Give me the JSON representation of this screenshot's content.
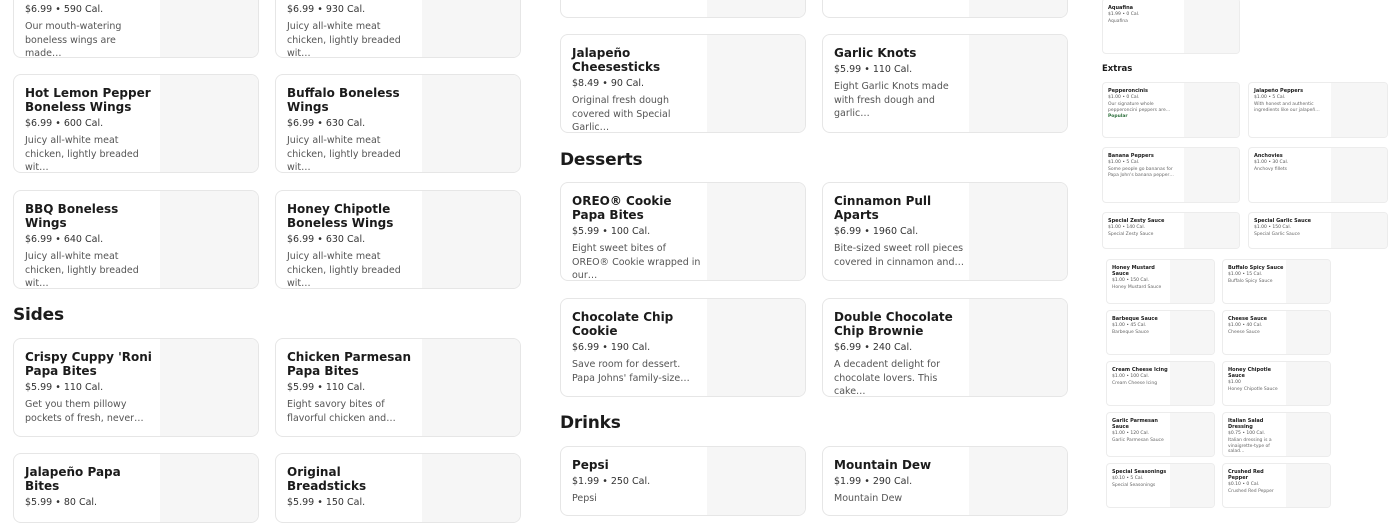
{
  "col1": [
    {
      "name": "",
      "meta": "$6.99 • 590 Cal.",
      "desc": "Our mouth-watering boneless wings are made…"
    },
    {
      "name": "Hot Lemon Pepper Boneless Wings",
      "meta": "$6.99 • 600 Cal.",
      "desc": "Juicy all-white meat chicken, lightly breaded wit…"
    },
    {
      "name": "BBQ Boneless Wings",
      "meta": "$6.99 • 640 Cal.",
      "desc": "Juicy all-white meat chicken, lightly breaded wit…"
    },
    {
      "name": "Crispy Cuppy 'Roni Papa Bites",
      "meta": "$5.99 • 110 Cal.",
      "desc": "Get you them pillowy pockets of fresh, never…"
    },
    {
      "name": "Jalapeño Papa Bites",
      "meta": "$5.99 • 80 Cal.",
      "desc": ""
    }
  ],
  "col2": [
    {
      "name": "",
      "meta": "$6.99 • 930 Cal.",
      "desc": "Juicy all-white meat chicken, lightly breaded wit…"
    },
    {
      "name": "Buffalo Boneless Wings",
      "meta": "$6.99 • 630 Cal.",
      "desc": "Juicy all-white meat chicken, lightly breaded wit…"
    },
    {
      "name": "Honey Chipotle Boneless Wings",
      "meta": "$6.99 • 630 Cal.",
      "desc": "Juicy all-white meat chicken, lightly breaded wit…"
    },
    {
      "name": "Chicken Parmesan Papa Bites",
      "meta": "$5.99 • 110 Cal.",
      "desc": "Eight savory bites of flavorful chicken and…"
    },
    {
      "name": "Original Breadsticks",
      "meta": "$5.99 • 150 Cal.",
      "desc": ""
    }
  ],
  "sections": {
    "sides": "Sides",
    "desserts": "Desserts",
    "drinks": "Drinks",
    "extras": "Extras"
  },
  "col3": [
    {
      "name": "Jalapeño Cheesesticks",
      "meta": "$8.49 • 90 Cal.",
      "desc": "Original fresh dough covered with Special Garlic…"
    },
    {
      "name": "OREO® Cookie Papa Bites",
      "meta": "$5.99 • 100 Cal.",
      "desc": "Eight sweet bites of OREO® Cookie wrapped in our…"
    },
    {
      "name": "Chocolate Chip Cookie",
      "meta": "$6.99 • 190 Cal.",
      "desc": "Save room for dessert. Papa Johns' family-size…"
    },
    {
      "name": "Pepsi",
      "meta": "$1.99 • 250 Cal.",
      "desc": "Pepsi"
    }
  ],
  "col4": [
    {
      "name": "Garlic Knots",
      "meta": "$5.99 • 110 Cal.",
      "desc": "Eight Garlic Knots made with fresh dough and garlic…"
    },
    {
      "name": "Cinnamon Pull Aparts",
      "meta": "$6.99 • 1960 Cal.",
      "desc": "Bite-sized sweet roll pieces covered in cinnamon and…"
    },
    {
      "name": "Double Chocolate Chip Brownie",
      "meta": "$6.99 • 240 Cal.",
      "desc": "A decadent delight for chocolate lovers. This cake…"
    },
    {
      "name": "Mountain Dew",
      "meta": "$1.99 • 290 Cal.",
      "desc": "Mountain Dew"
    }
  ],
  "aquafina": {
    "name": "Aquafina",
    "meta": "$1.99 • 0 Cal.",
    "desc": "Aquafina"
  },
  "extras": [
    {
      "name": "Pepperoncinis",
      "meta": "$1.00 • 0 Cal.",
      "desc": "Our signature whole pepperoncini peppers are…",
      "badge": "Popular"
    },
    {
      "name": "Jalapeño Peppers",
      "meta": "$1.00 • 5 Cal.",
      "desc": "With honest and authentic ingredients like our jalapeñ…",
      "badge": ""
    },
    {
      "name": "Banana Peppers",
      "meta": "$1.00 • 5 Cal.",
      "desc": "Some people go bananas for Papa John's banana pepper…",
      "badge": ""
    },
    {
      "name": "Anchovies",
      "meta": "$1.00 • 30 Cal.",
      "desc": "Anchovy fillets",
      "badge": ""
    },
    {
      "name": "Special Zesty Sauce",
      "meta": "$1.00 • 140 Cal.",
      "desc": "Special Zesty Sauce",
      "badge": ""
    },
    {
      "name": "Special Garlic Sauce",
      "meta": "$1.00 • 150 Cal.",
      "desc": "Special Garlic Sauce",
      "badge": ""
    },
    {
      "name": "Honey Mustard Sauce",
      "meta": "$1.00 • 150 Cal.",
      "desc": "Honey Mustard Sauce",
      "badge": ""
    },
    {
      "name": "Buffalo Spicy Sauce",
      "meta": "$1.00 • 15 Cal.",
      "desc": "Buffalo Spicy Sauce",
      "badge": ""
    },
    {
      "name": "Barbeque Sauce",
      "meta": "$1.00 • 45 Cal.",
      "desc": "Barbeque Sauce",
      "badge": ""
    },
    {
      "name": "Cheese Sauce",
      "meta": "$1.00 • 40 Cal.",
      "desc": "Cheese Sauce",
      "badge": ""
    },
    {
      "name": "Cream Cheese Icing",
      "meta": "$1.00 • 100 Cal.",
      "desc": "Cream Cheese Icing",
      "badge": ""
    },
    {
      "name": "Honey Chipotle Sauce",
      "meta": "$1.00",
      "desc": "Honey Chipotle Sauce",
      "badge": ""
    },
    {
      "name": "Garlic Parmesan Sauce",
      "meta": "$1.00 • 120 Cal.",
      "desc": "Garlic Parmesan Sauce",
      "badge": ""
    },
    {
      "name": "Italian Salad Dressing",
      "meta": "$0.75 • 100 Cal.",
      "desc": "Italian dressing is a vinaigrette-type of salad…",
      "badge": ""
    },
    {
      "name": "Special Seasonings",
      "meta": "$0.10 • 5 Cal.",
      "desc": "Special Seasonings",
      "badge": ""
    },
    {
      "name": "Crushed Red Pepper",
      "meta": "$0.10 • 0 Cal.",
      "desc": "Crushed Red Pepper",
      "badge": ""
    }
  ]
}
